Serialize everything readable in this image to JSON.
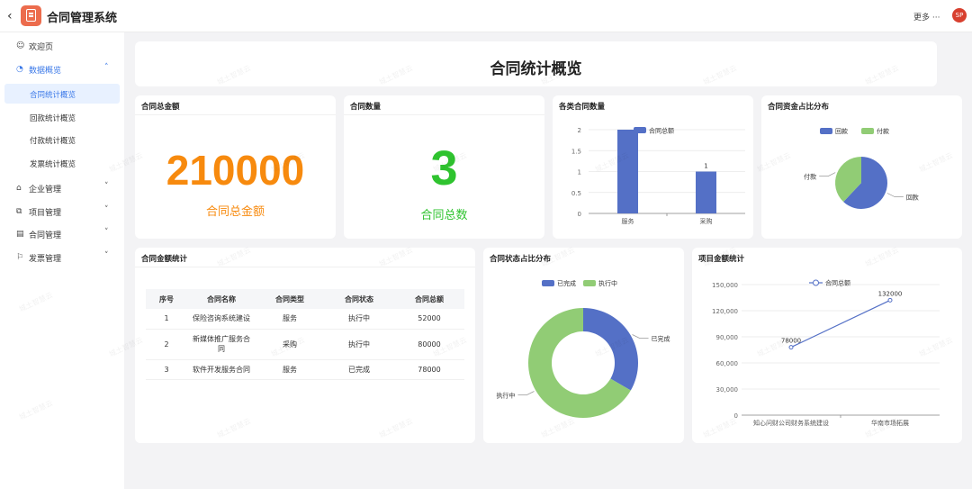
{
  "app": {
    "title": "合同管理系统",
    "back_icon": "chevron-left-icon",
    "more_label": "更多 ···",
    "avatar_text": "SP"
  },
  "sidebar": {
    "welcome": {
      "label": "欢迎页",
      "icon": "smile-icon"
    },
    "overview": {
      "label": "数据概览",
      "icon": "pie-icon",
      "items": [
        {
          "label": "合同统计概览",
          "active": true
        },
        {
          "label": "回款统计概览"
        },
        {
          "label": "付款统计概览"
        },
        {
          "label": "发票统计概览"
        }
      ]
    },
    "groups": [
      {
        "label": "企业管理",
        "icon": "bank-icon"
      },
      {
        "label": "项目管理",
        "icon": "project-icon"
      },
      {
        "label": "合同管理",
        "icon": "contract-icon"
      },
      {
        "label": "发票管理",
        "icon": "flag-icon"
      }
    ]
  },
  "page": {
    "title": "合同统计概览"
  },
  "total_amount": {
    "header": "合同总金额",
    "value": "210000",
    "caption": "合同总金额",
    "color": "#f78a0e"
  },
  "contract_count": {
    "header": "合同数量",
    "value": "3",
    "caption": "合同总数",
    "color": "#2fc32f"
  },
  "category_chart": {
    "header": "各类合同数量",
    "chart_data": {
      "type": "bar",
      "categories": [
        "服务",
        "采购"
      ],
      "series": [
        {
          "name": "合同总额",
          "values": [
            2,
            1
          ]
        }
      ],
      "ylim": [
        0,
        2
      ],
      "yticks": [
        "0",
        "0.5",
        "1",
        "1.5",
        "2"
      ],
      "data_labels": [
        "",
        "1"
      ],
      "color": "#5470c6"
    }
  },
  "fund_chart": {
    "header": "合同资金占比分布",
    "chart_data": {
      "type": "pie",
      "labels": [
        "回款",
        "付款"
      ],
      "values": [
        62,
        38
      ],
      "colors": [
        "#5470c6",
        "#91cc75"
      ]
    }
  },
  "amount_table": {
    "header": "合同金额统计",
    "columns": [
      "序号",
      "合同名称",
      "合同类型",
      "合同状态",
      "合同总额"
    ],
    "rows": [
      [
        "1",
        "保险咨询系统建设",
        "服务",
        "执行中",
        "52000"
      ],
      [
        "2",
        "新媒体推广服务合同",
        "采购",
        "执行中",
        "80000"
      ],
      [
        "3",
        "软件开发服务合同",
        "服务",
        "已完成",
        "78000"
      ]
    ]
  },
  "status_chart": {
    "header": "合同状态占比分布",
    "chart_data": {
      "type": "pie",
      "labels": [
        "已完成",
        "执行中"
      ],
      "values": [
        1,
        2
      ],
      "colors": [
        "#5470c6",
        "#91cc75"
      ]
    }
  },
  "project_chart": {
    "header": "项目金额统计",
    "chart_data": {
      "type": "line",
      "categories": [
        "知心问财公司财务系统建设",
        "华南市场拓展"
      ],
      "series": [
        {
          "name": "合同总额",
          "values": [
            78000,
            132000
          ]
        }
      ],
      "data_labels": [
        "78000",
        "132000"
      ],
      "ylim": [
        0,
        150000
      ],
      "yticks": [
        "0",
        "30,000",
        "60,000",
        "90,000",
        "120,000",
        "150,000"
      ],
      "color": "#5470c6"
    }
  },
  "watermark": "城土智慧云"
}
